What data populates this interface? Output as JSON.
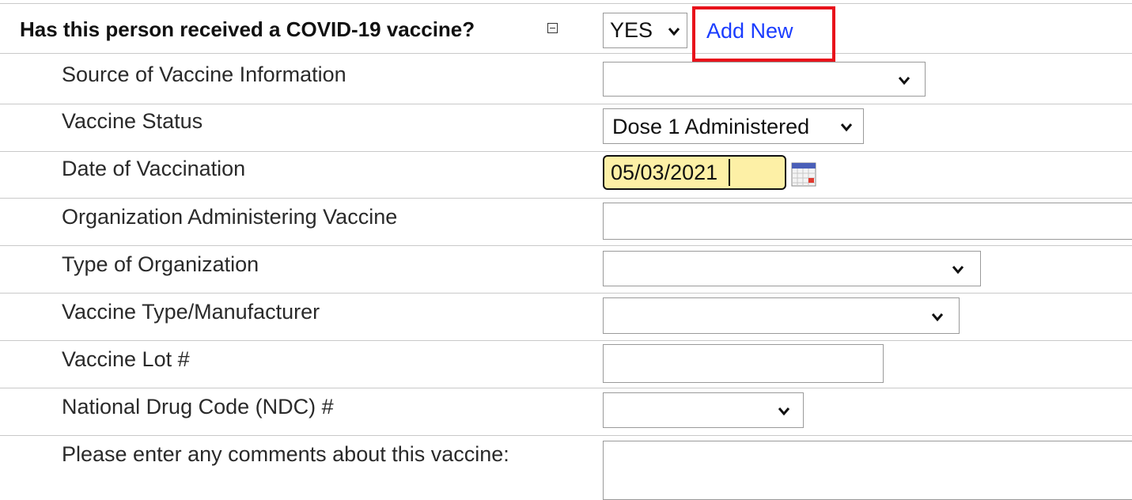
{
  "question": {
    "label": "Has this person received a COVID-19 vaccine?",
    "answer": "YES",
    "add_new": "Add New"
  },
  "fields": {
    "source": {
      "label": "Source of Vaccine Information",
      "value": ""
    },
    "status": {
      "label": "Vaccine Status",
      "value": "Dose 1 Administered"
    },
    "date": {
      "label": "Date of Vaccination",
      "value": "05/03/2021"
    },
    "org": {
      "label": "Organization Administering Vaccine",
      "value": ""
    },
    "org_type": {
      "label": "Type of Organization",
      "value": ""
    },
    "manufacturer": {
      "label": "Vaccine Type/Manufacturer",
      "value": ""
    },
    "lot": {
      "label": "Vaccine Lot #",
      "value": ""
    },
    "ndc": {
      "label": "National Drug Code (NDC) #",
      "value": ""
    },
    "comments": {
      "label": "Please enter any comments about this vaccine:",
      "value": ""
    }
  },
  "colors": {
    "highlight_border": "#e8121b",
    "link": "#1a3cff",
    "date_bg": "#fdf0a6"
  },
  "icons": {
    "collapse": "collapse-minus-icon",
    "calendar": "calendar-icon",
    "dropdown": "chevron-down-icon"
  }
}
